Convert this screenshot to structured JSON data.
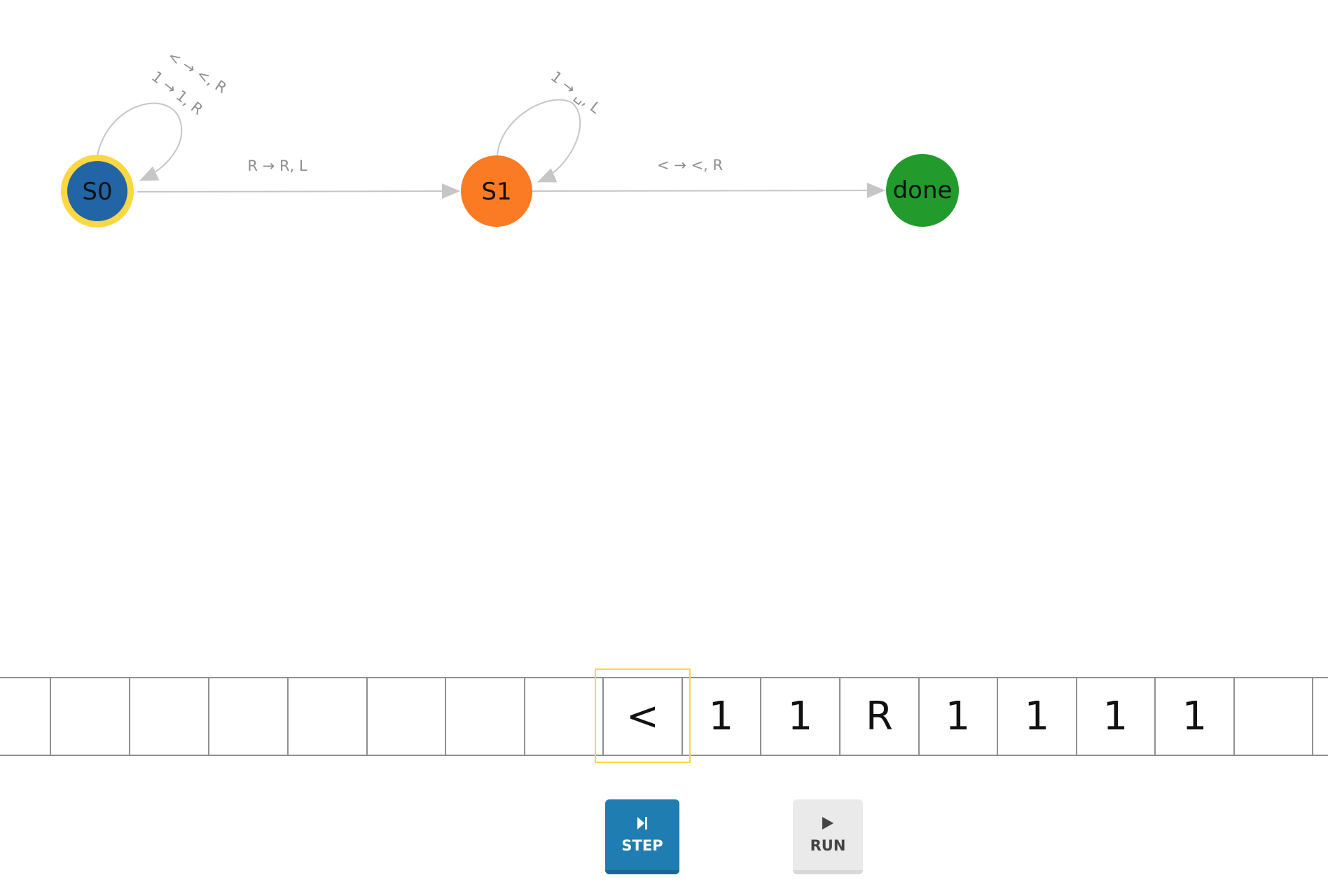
{
  "states": [
    {
      "id": "s0",
      "label": "S0",
      "color": "#2265a6",
      "current": true
    },
    {
      "id": "s1",
      "label": "S1",
      "color": "#fb7a24"
    },
    {
      "id": "done",
      "label": "done",
      "color": "#229b2c"
    }
  ],
  "current_state_ring_color": "#fbd744",
  "transitions": {
    "s0_loop": [
      "< → <, R",
      "1 → 1, R"
    ],
    "s0_to_s1": "R → R, L",
    "s1_loop": "1 → ␣, L",
    "s1_to_done": "< → <, R"
  },
  "tape": {
    "cells": [
      "",
      "",
      "",
      "",
      "",
      "",
      "",
      "",
      "<",
      "1",
      "1",
      "R",
      "1",
      "1",
      "1",
      "1",
      ""
    ],
    "head_index": 8
  },
  "controls": {
    "step_label": "STEP",
    "step_icon": "step-forward-icon",
    "run_label": "RUN",
    "run_icon": "play-icon"
  }
}
